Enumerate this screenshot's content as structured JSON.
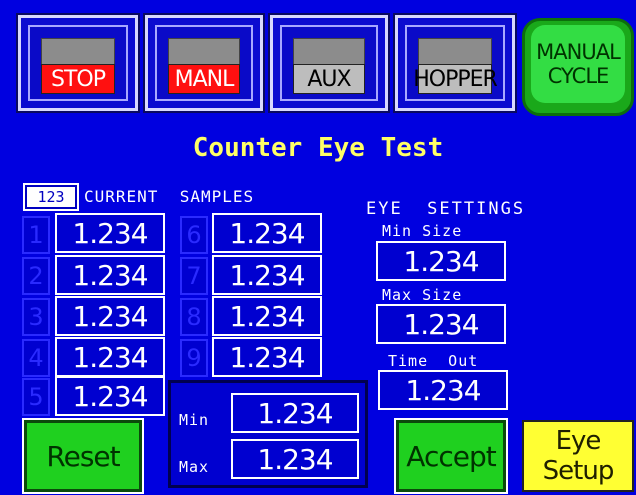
{
  "status": {
    "stop": "STOP",
    "manl": "MANL",
    "aux": "AUX",
    "hopper": "HOPPER",
    "manual_cycle_line1": "MANUAL",
    "manual_cycle_line2": "CYCLE"
  },
  "title": "Counter Eye Test",
  "samples": {
    "badge": "123",
    "header": "CURRENT  SAMPLES",
    "left": [
      {
        "index": "1",
        "value": "1.234"
      },
      {
        "index": "2",
        "value": "1.234"
      },
      {
        "index": "3",
        "value": "1.234"
      },
      {
        "index": "4",
        "value": "1.234"
      },
      {
        "index": "5",
        "value": "1.234"
      }
    ],
    "right": [
      {
        "index": "6",
        "value": "1.234"
      },
      {
        "index": "7",
        "value": "1.234"
      },
      {
        "index": "8",
        "value": "1.234"
      },
      {
        "index": "9",
        "value": "1.234"
      }
    ]
  },
  "minmax": {
    "min_label": "Min",
    "min_value": "1.234",
    "max_label": "Max",
    "max_value": "1.234"
  },
  "eye_settings": {
    "header": "EYE  SETTINGS",
    "min_size_label": "Min Size",
    "min_size_value": "1.234",
    "max_size_label": "Max Size",
    "max_size_value": "1.234",
    "time_out_label": "Time  Out",
    "time_out_value": "1.234"
  },
  "buttons": {
    "reset": "Reset",
    "accept": "Accept",
    "eye_setup_line1": "Eye",
    "eye_setup_line2": "Setup"
  },
  "colors": {
    "background": "#0000e0",
    "title": "#ffff66",
    "alarm_red": "#ff1010",
    "indicator_grey": "#bdbdbd",
    "button_green": "#1fd01f",
    "button_yellow": "#ffff33"
  }
}
